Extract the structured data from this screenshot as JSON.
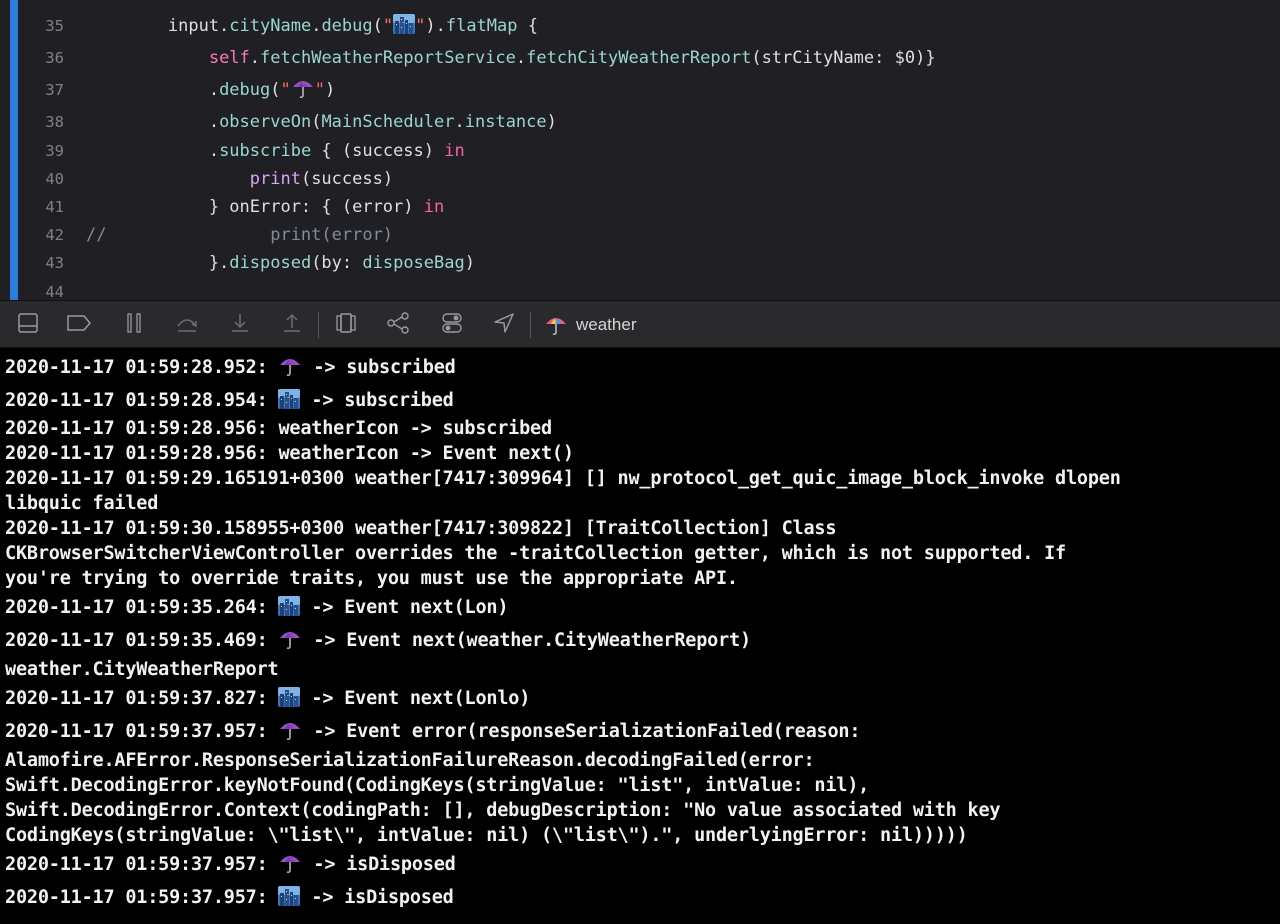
{
  "editor": {
    "lines": [
      {
        "num": "35",
        "parts": [
          [
            "",
            "        input."
          ],
          [
            "t-prop",
            "cityName"
          ],
          [
            "",
            "."
          ],
          [
            "t-prop",
            "debug"
          ],
          [
            "",
            "("
          ],
          [
            "t-str",
            "\""
          ],
          [
            "icon",
            "city"
          ],
          [
            "t-str",
            "\""
          ],
          [
            "",
            ")."
          ],
          [
            "t-prop",
            "flatMap"
          ],
          [
            "",
            " {"
          ]
        ]
      },
      {
        "num": "36",
        "parts": [
          [
            "",
            "            "
          ],
          [
            "t-self",
            "self"
          ],
          [
            "",
            "."
          ],
          [
            "t-prop",
            "fetchWeatherReportService"
          ],
          [
            "",
            "."
          ],
          [
            "t-prop",
            "fetchCityWeatherReport"
          ],
          [
            "",
            "(strCityName: $0)}"
          ]
        ]
      },
      {
        "num": "37",
        "parts": [
          [
            "",
            "            ."
          ],
          [
            "t-prop",
            "debug"
          ],
          [
            "",
            "("
          ],
          [
            "t-str",
            "\""
          ],
          [
            "icon",
            "umbrella"
          ],
          [
            "t-str",
            "\""
          ],
          [
            "",
            ")"
          ]
        ]
      },
      {
        "num": "38",
        "parts": [
          [
            "",
            "            ."
          ],
          [
            "t-prop",
            "observeOn"
          ],
          [
            "",
            "("
          ],
          [
            "t-type",
            "MainScheduler"
          ],
          [
            "",
            "."
          ],
          [
            "t-prop",
            "instance"
          ],
          [
            "",
            ")"
          ]
        ]
      },
      {
        "num": "39",
        "parts": [
          [
            "",
            "            ."
          ],
          [
            "t-prop",
            "subscribe"
          ],
          [
            "",
            " { (success) "
          ],
          [
            "t-kw",
            "in"
          ]
        ]
      },
      {
        "num": "40",
        "parts": [
          [
            "",
            "                "
          ],
          [
            "t-fn",
            "print"
          ],
          [
            "",
            "(success)"
          ]
        ]
      },
      {
        "num": "41",
        "parts": [
          [
            "",
            "            } onError: { (error) "
          ],
          [
            "t-kw",
            "in"
          ]
        ]
      },
      {
        "num": "42",
        "parts": [
          [
            "t-com",
            "//                print(error)"
          ]
        ]
      },
      {
        "num": "43",
        "parts": [
          [
            "",
            "            }."
          ],
          [
            "t-prop",
            "disposed"
          ],
          [
            "",
            "(by: "
          ],
          [
            "t-prop",
            "disposeBag"
          ],
          [
            "",
            ")"
          ]
        ]
      },
      {
        "num": "44",
        "parts": []
      }
    ]
  },
  "toolbar": {
    "buttons": [
      {
        "name": "hide-debug-area-button",
        "icon": "panel-icon"
      },
      {
        "name": "breakpoints-toggle-button",
        "icon": "breakpoint-icon"
      },
      {
        "name": "pause-button",
        "icon": "pause-icon"
      },
      {
        "name": "step-over-button",
        "icon": "step-over-icon"
      },
      {
        "name": "step-into-button",
        "icon": "step-into-icon"
      },
      {
        "name": "step-out-button",
        "icon": "step-out-icon"
      },
      {
        "name": "view-hierarchy-button",
        "icon": "view-hierarchy-icon"
      },
      {
        "name": "memory-graph-button",
        "icon": "memory-graph-icon"
      },
      {
        "name": "environment-overrides-button",
        "icon": "toggles-icon"
      },
      {
        "name": "simulate-location-button",
        "icon": "location-icon"
      }
    ],
    "process_name": "weather",
    "process_icon": "umbrella-icon"
  },
  "console": {
    "lines": [
      {
        "ts": "2020-11-17 01:59:28.952: ",
        "icon": "umbrella",
        "text": " -> subscribed"
      },
      {
        "ts": "2020-11-17 01:59:28.954: ",
        "icon": "city",
        "text": " -> subscribed"
      },
      {
        "ts": "",
        "icon": "",
        "text": "2020-11-17 01:59:28.956: weatherIcon -> subscribed"
      },
      {
        "ts": "",
        "icon": "",
        "text": "2020-11-17 01:59:28.956: weatherIcon -> Event next()"
      },
      {
        "ts": "",
        "icon": "",
        "text": "2020-11-17 01:59:29.165191+0300 weather[7417:309964] [] nw_protocol_get_quic_image_block_invoke dlopen"
      },
      {
        "ts": "",
        "icon": "",
        "text": "libquic failed"
      },
      {
        "ts": "",
        "icon": "",
        "text": "2020-11-17 01:59:30.158955+0300 weather[7417:309822] [TraitCollection] Class"
      },
      {
        "ts": "",
        "icon": "",
        "text": "CKBrowserSwitcherViewController overrides the -traitCollection getter, which is not supported. If"
      },
      {
        "ts": "",
        "icon": "",
        "text": "you're trying to override traits, you must use the appropriate API."
      },
      {
        "ts": "2020-11-17 01:59:35.264: ",
        "icon": "city",
        "text": " -> Event next(Lon)"
      },
      {
        "ts": "2020-11-17 01:59:35.469: ",
        "icon": "umbrella",
        "text": " -> Event next(weather.CityWeatherReport)"
      },
      {
        "ts": "",
        "icon": "",
        "text": "weather.CityWeatherReport"
      },
      {
        "ts": "2020-11-17 01:59:37.827: ",
        "icon": "city",
        "text": " -> Event next(Lonlo)"
      },
      {
        "ts": "2020-11-17 01:59:37.957: ",
        "icon": "umbrella",
        "text": " -> Event error(responseSerializationFailed(reason:"
      },
      {
        "ts": "",
        "icon": "",
        "text": "Alamofire.AFError.ResponseSerializationFailureReason.decodingFailed(error:"
      },
      {
        "ts": "",
        "icon": "",
        "text": "Swift.DecodingError.keyNotFound(CodingKeys(stringValue: \"list\", intValue: nil),"
      },
      {
        "ts": "",
        "icon": "",
        "text": "Swift.DecodingError.Context(codingPath: [], debugDescription: \"No value associated with key"
      },
      {
        "ts": "",
        "icon": "",
        "text": "CodingKeys(stringValue: \\\"list\\\", intValue: nil) (\\\"list\\\").\", underlyingError: nil)))))"
      },
      {
        "ts": "2020-11-17 01:59:37.957: ",
        "icon": "umbrella",
        "text": " -> isDisposed"
      },
      {
        "ts": "2020-11-17 01:59:37.957: ",
        "icon": "city",
        "text": " -> isDisposed"
      }
    ]
  },
  "colors": {
    "editor_bg": "#1f1f24",
    "change_bar": "#2d7ce0",
    "toolbar_bg": "#2a2a2d",
    "console_bg": "#000000"
  }
}
